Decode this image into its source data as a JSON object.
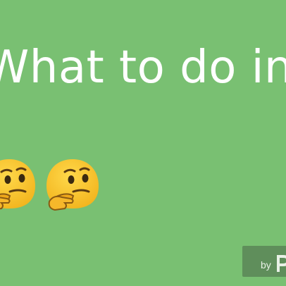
{
  "headline": "What to do in Nepal",
  "emojis": [
    {
      "icon": "thinking-face-icon"
    },
    {
      "icon": "thinking-face-icon"
    }
  ],
  "watermark": {
    "by_text": "by",
    "logo_icon": "brand-logo-icon"
  },
  "colors": {
    "background": "#79c072",
    "headline_text": "#ffffff",
    "badge_background": "#5f8e5b",
    "emoji_face": "#f8c22f"
  }
}
